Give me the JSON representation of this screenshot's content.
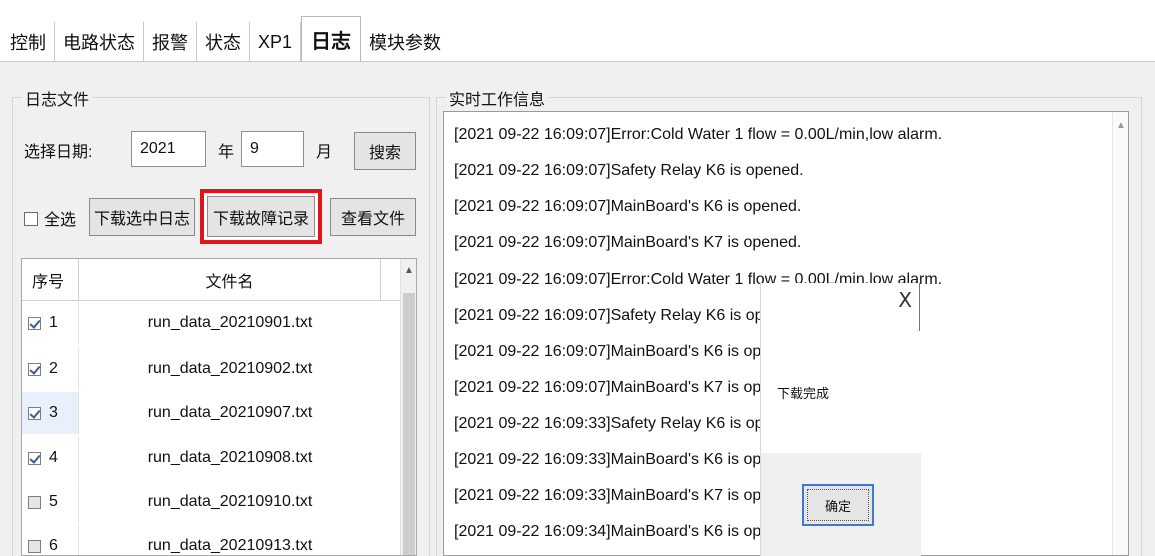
{
  "tabs": [
    {
      "label": "控制"
    },
    {
      "label": "电路状态"
    },
    {
      "label": "报警"
    },
    {
      "label": "状态"
    },
    {
      "label": "XP1"
    },
    {
      "label": "日志",
      "active": true
    },
    {
      "label": "模块参数"
    }
  ],
  "log_files": {
    "group_title": "日志文件",
    "date_label": "选择日期:",
    "year_value": "2021",
    "year_unit": "年",
    "month_value": "9",
    "month_unit": "月",
    "search_label": "搜索",
    "select_all_label": "全选",
    "download_selected_label": "下载选中日志",
    "download_fault_label": "下载故障记录",
    "view_file_label": "查看文件",
    "table": {
      "col_num": "序号",
      "col_name": "文件名",
      "rows": [
        {
          "num": "1",
          "name": "run_data_20210901.txt",
          "checked": true
        },
        {
          "num": "2",
          "name": "run_data_20210902.txt",
          "checked": true
        },
        {
          "num": "3",
          "name": "run_data_20210907.txt",
          "checked": true
        },
        {
          "num": "4",
          "name": "run_data_20210908.txt",
          "checked": true
        },
        {
          "num": "5",
          "name": "run_data_20210910.txt",
          "checked": false
        },
        {
          "num": "6",
          "name": "run_data_20210913.txt",
          "checked": false
        }
      ]
    }
  },
  "realtime": {
    "group_title": "实时工作信息",
    "lines": [
      "[2021 09-22 16:09:07]Error:Cold Water 1 flow = 0.00L/min,low alarm.",
      "[2021 09-22 16:09:07]Safety Relay K6 is opened.",
      "[2021 09-22 16:09:07]MainBoard's K6 is opened.",
      "[2021 09-22 16:09:07]MainBoard's K7 is opened.",
      "[2021 09-22 16:09:07]Error:Cold Water 1 flow = 0.00L/min,low alarm.",
      "[2021 09-22 16:09:07]Safety Relay K6 is opened.",
      "[2021 09-22 16:09:07]MainBoard's K6 is opened.",
      "[2021 09-22 16:09:07]MainBoard's K7 is opened.",
      "[2021 09-22 16:09:33]Safety Relay K6 is opened.",
      "[2021 09-22 16:09:33]MainBoard's K6 is opened.",
      "[2021 09-22 16:09:33]MainBoard's K7 is opened.",
      "[2021 09-22 16:09:34]MainBoard's K6 is opened."
    ]
  },
  "dialog": {
    "close_glyph": "X",
    "message": "下载完成",
    "ok_label": "确定"
  }
}
